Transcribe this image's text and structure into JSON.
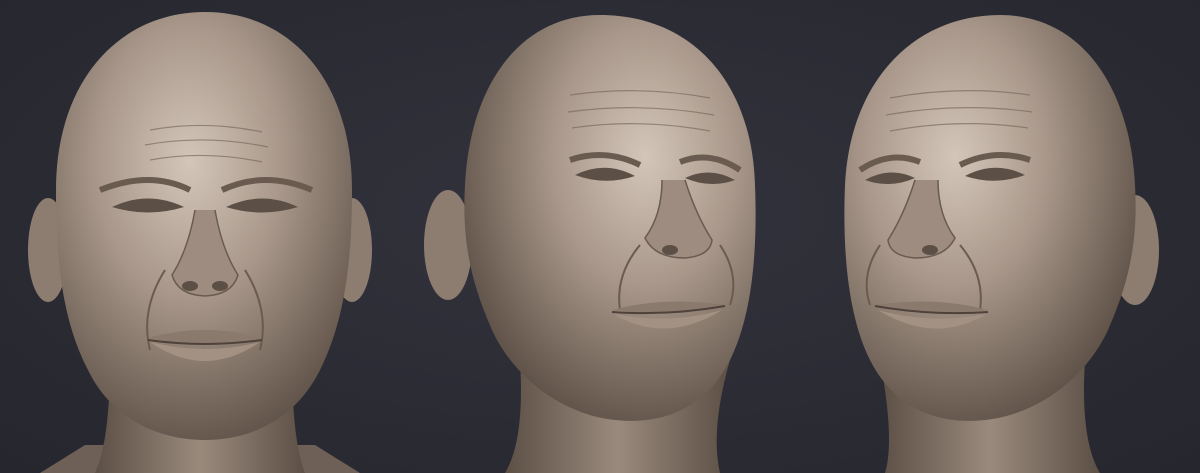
{
  "scene": {
    "background_color": "#2b2b34",
    "clay_color": "#a8978a",
    "clay_shadow_color": "#5c4f45",
    "clay_highlight_color": "#d3c6b9",
    "views": [
      {
        "id": "front",
        "subject": "sculpted-head-front-view"
      },
      {
        "id": "three-quarter-right",
        "subject": "sculpted-head-three-quarter-right-view"
      },
      {
        "id": "three-quarter-left",
        "subject": "sculpted-head-three-quarter-left-view"
      }
    ]
  }
}
